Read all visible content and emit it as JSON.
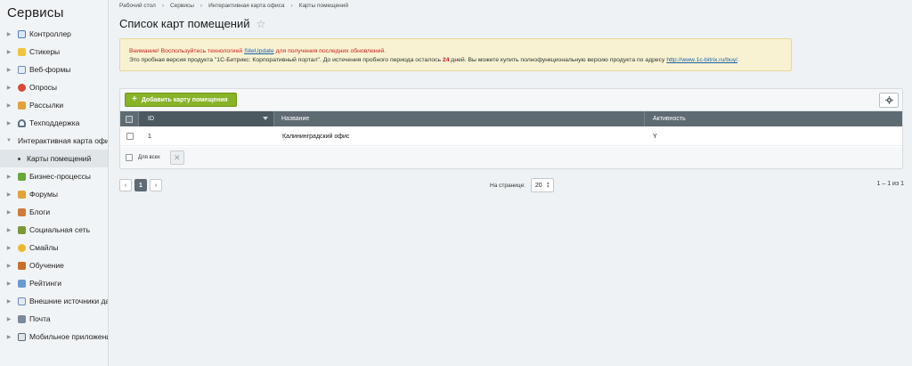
{
  "sidebar": {
    "title": "Сервисы",
    "items": [
      {
        "label": "Контроллер",
        "icon": "controller-icon",
        "color": "#4d7ec2"
      },
      {
        "label": "Стикеры",
        "icon": "stickers-icon",
        "color": "#e8b92f"
      },
      {
        "label": "Веб-формы",
        "icon": "webforms-icon",
        "color": "#6c8cbf"
      },
      {
        "label": "Опросы",
        "icon": "polls-icon",
        "color": "#d8493a"
      },
      {
        "label": "Рассылки",
        "icon": "mailing-icon",
        "color": "#e0a33a"
      },
      {
        "label": "Техподдержка",
        "icon": "support-icon",
        "color": "#5a7289"
      },
      {
        "label": "Интерактивная карта офиса",
        "icon": "",
        "color": ""
      },
      {
        "label": "Карты помещений",
        "icon": "",
        "color": ""
      },
      {
        "label": "Бизнес-процессы",
        "icon": "bizproc-icon",
        "color": "#6aa83a"
      },
      {
        "label": "Форумы",
        "icon": "forums-icon",
        "color": "#e0a33a"
      },
      {
        "label": "Блоги",
        "icon": "blogs-icon",
        "color": "#d07a3a"
      },
      {
        "label": "Социальная сеть",
        "icon": "social-icon",
        "color": "#7a9a3a"
      },
      {
        "label": "Смайлы",
        "icon": "smiles-icon",
        "color": "#e8b92f"
      },
      {
        "label": "Обучение",
        "icon": "learning-icon",
        "color": "#c8702a"
      },
      {
        "label": "Рейтинги",
        "icon": "ratings-icon",
        "color": "#6a9ad0"
      },
      {
        "label": "Внешние источники данных",
        "icon": "external-data-icon",
        "color": "#6a8ac0"
      },
      {
        "label": "Почта",
        "icon": "mail-icon",
        "color": "#7a8a9a"
      },
      {
        "label": "Мобильное приложение",
        "icon": "mobile-icon",
        "color": "#5a6a7a"
      }
    ]
  },
  "breadcrumb": [
    "Рабочий стол",
    "Сервисы",
    "Интерактивная карта офиса",
    "Карты помещений"
  ],
  "page": {
    "title": "Список карт помещений"
  },
  "notice": {
    "warn_prefix": "Внимание! Воспользуйтесь технологией ",
    "warn_link": "SiteUpdate",
    "warn_suffix": " для получения последних обновлений.",
    "line2_prefix": "Это пробная версия продукта \"1С-Битрикс: Корпоративный портал\". До истечения пробного периода осталось ",
    "days": "24",
    "line2_mid": " дней. Вы можете купить полнофункциональную версию продукта по адресу ",
    "line2_link": "http://www.1c-bitrix.ru/buy/",
    "line2_end": "."
  },
  "toolbar": {
    "add_label": "Добавить карту помещения"
  },
  "table": {
    "columns": [
      "ID",
      "Название",
      "Активность"
    ],
    "rows": [
      {
        "id": "1",
        "name": "Калининградский офис",
        "active": "Y"
      }
    ],
    "for_all_label": "Для всех"
  },
  "pager": {
    "current": "1",
    "prev": "‹",
    "next": "›"
  },
  "per_page": {
    "label": "На странице:",
    "value": "20"
  },
  "count_text": "1 – 1 из 1",
  "colors": {
    "accent_green": "#88b228",
    "header_dark": "#5f6b73",
    "notice_bg": "#f8f2d2"
  }
}
